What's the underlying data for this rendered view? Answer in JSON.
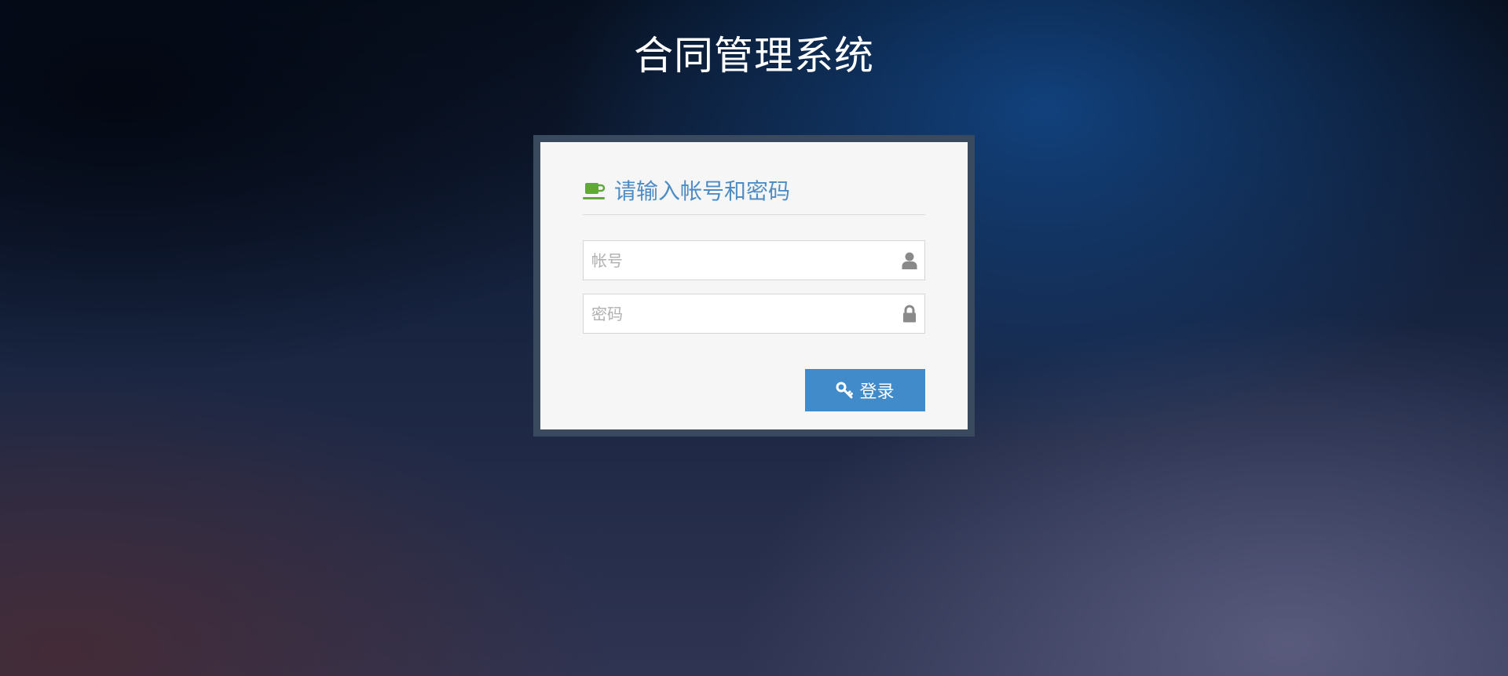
{
  "page": {
    "title": "合同管理系统"
  },
  "login": {
    "heading": "请输入帐号和密码",
    "heading_icon": "coffee-icon",
    "username": {
      "value": "",
      "placeholder": "帐号",
      "icon": "user-icon"
    },
    "password": {
      "value": "",
      "placeholder": "密码",
      "icon": "lock-icon"
    },
    "submit": {
      "label": "登录",
      "icon": "key-icon"
    }
  },
  "colors": {
    "heading": "#4f8cc4",
    "heading_icon": "#5fa839",
    "button": "#428bca",
    "frame": "#3a4a5e",
    "panel": "#f6f6f6"
  }
}
